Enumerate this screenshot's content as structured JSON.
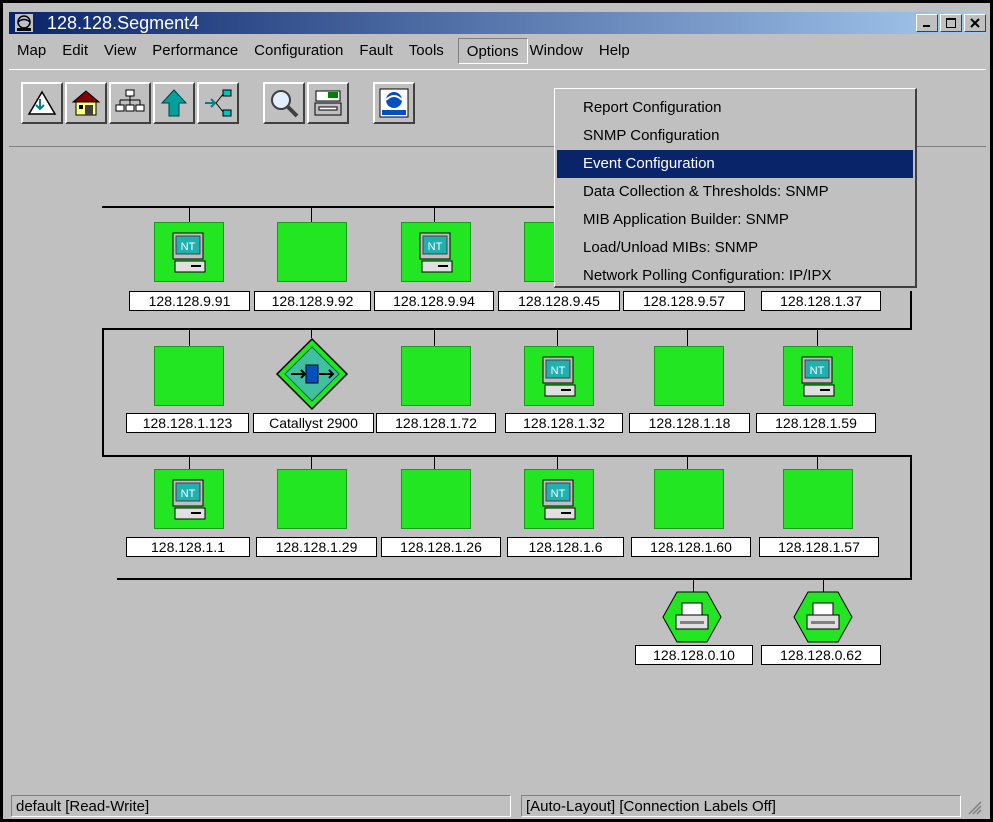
{
  "window": {
    "title": "128.128.Segment4"
  },
  "menubar": {
    "items": [
      "Map",
      "Edit",
      "View",
      "Performance",
      "Configuration",
      "Fault",
      "Tools",
      "Options",
      "Window",
      "Help"
    ]
  },
  "toolbar": {
    "buttons": [
      "close-submap-icon",
      "home-icon",
      "hierarchy-icon",
      "up-arrow-icon",
      "neighbors-icon",
      "find-icon",
      "printer-config-icon",
      "hp-openview-icon"
    ]
  },
  "options_menu": {
    "items": [
      "Report Configuration",
      "SNMP Configuration",
      "Event Configuration",
      "Data Collection & Thresholds: SNMP",
      "MIB Application Builder: SNMP",
      "Load/Unload MIBs: SNMP",
      "Network Polling Configuration: IP/IPX"
    ],
    "highlighted": "Event Configuration"
  },
  "nodes": {
    "row1": [
      "128.128.9.91",
      "128.128.9.92",
      "128.128.9.94",
      "128.128.9.45",
      "128.128.9.57",
      "128.128.1.37"
    ],
    "row2": [
      "128.128.1.123",
      "Catallyst 2900",
      "128.128.1.72",
      "128.128.1.32",
      "128.128.1.18",
      "128.128.1.59"
    ],
    "row3": [
      "128.128.1.1",
      "128.128.1.29",
      "128.128.1.26",
      "128.128.1.6",
      "128.128.1.60",
      "128.128.1.57"
    ],
    "row4": [
      "128.128.0.10",
      "128.128.0.62"
    ]
  },
  "colors": {
    "node_green": "#22e622",
    "canvas_gray": "#c0c0c0",
    "selection_blue": "#0a246a"
  },
  "statusbar": {
    "left": "default [Read-Write]",
    "right": "[Auto-Layout] [Connection Labels Off]"
  }
}
